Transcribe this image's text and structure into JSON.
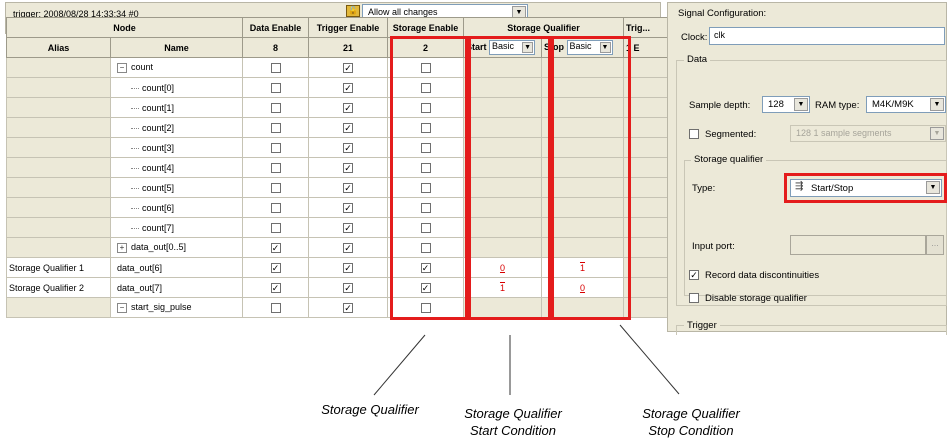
{
  "trigger_bar": {
    "title": "trigger: 2008/08/28 14:33:34  #0",
    "change_mode": "Allow all changes"
  },
  "columns": {
    "node": "Node",
    "alias": "Alias",
    "name": "Name",
    "data_enable": "Data Enable",
    "trigger_enable": "Trigger Enable",
    "storage_enable": "Storage Enable",
    "storage_qualifier": "Storage Qualifier",
    "trig": "Trig...",
    "data_enable_count": "8",
    "trigger_enable_count": "21",
    "storage_enable_count": "2",
    "start": "Start",
    "start_mode": "Basic",
    "stop": "Stop",
    "stop_mode": "Basic",
    "trig_sub": "1 E"
  },
  "rows": [
    {
      "alias": "",
      "name": "count",
      "tree": "minus",
      "indent": 0,
      "data": false,
      "trigger": true,
      "storage": false,
      "start": "",
      "stop": ""
    },
    {
      "alias": "",
      "name": "count[0]",
      "tree": "leaf",
      "indent": 1,
      "data": false,
      "trigger": true,
      "storage": false,
      "start": "",
      "stop": ""
    },
    {
      "alias": "",
      "name": "count[1]",
      "tree": "leaf",
      "indent": 1,
      "data": false,
      "trigger": true,
      "storage": false,
      "start": "",
      "stop": ""
    },
    {
      "alias": "",
      "name": "count[2]",
      "tree": "leaf",
      "indent": 1,
      "data": false,
      "trigger": true,
      "storage": false,
      "start": "",
      "stop": ""
    },
    {
      "alias": "",
      "name": "count[3]",
      "tree": "leaf",
      "indent": 1,
      "data": false,
      "trigger": true,
      "storage": false,
      "start": "",
      "stop": ""
    },
    {
      "alias": "",
      "name": "count[4]",
      "tree": "leaf",
      "indent": 1,
      "data": false,
      "trigger": true,
      "storage": false,
      "start": "",
      "stop": ""
    },
    {
      "alias": "",
      "name": "count[5]",
      "tree": "leaf",
      "indent": 1,
      "data": false,
      "trigger": true,
      "storage": false,
      "start": "",
      "stop": ""
    },
    {
      "alias": "",
      "name": "count[6]",
      "tree": "leaf",
      "indent": 1,
      "data": false,
      "trigger": true,
      "storage": false,
      "start": "",
      "stop": ""
    },
    {
      "alias": "",
      "name": "count[7]",
      "tree": "leaf",
      "indent": 1,
      "data": false,
      "trigger": true,
      "storage": false,
      "start": "",
      "stop": ""
    },
    {
      "alias": "",
      "name": "data_out[0..5]",
      "tree": "plus",
      "indent": 0,
      "data": true,
      "trigger": true,
      "storage": false,
      "start": "",
      "stop": ""
    },
    {
      "alias": "Storage Qualifier 1",
      "name": "data_out[6]",
      "tree": "none",
      "indent": 0,
      "data": true,
      "trigger": true,
      "storage": true,
      "start": "0",
      "stop": "1"
    },
    {
      "alias": "Storage Qualifier 2",
      "name": "data_out[7]",
      "tree": "none",
      "indent": 0,
      "data": true,
      "trigger": true,
      "storage": true,
      "start": "1",
      "stop": "0"
    },
    {
      "alias": "",
      "name": "start_sig_pulse",
      "tree": "minus",
      "indent": 0,
      "data": false,
      "trigger": true,
      "storage": false,
      "start": "",
      "stop": ""
    }
  ],
  "signal_config": {
    "title": "Signal Configuration:",
    "clock_label": "Clock:",
    "clock_value": "clk",
    "data_group": "Data",
    "sample_depth_label": "Sample depth:",
    "sample_depth_value": "128",
    "ram_type_label": "RAM type:",
    "ram_type_value": "M4K/M9K",
    "segmented_label": "Segmented:",
    "segmented_checked": false,
    "segments_value": "128  1 sample segments",
    "storage_qualifier_group": "Storage qualifier",
    "type_label": "Type:",
    "type_value": "Start/Stop",
    "input_port_label": "Input port:",
    "input_port_value": "",
    "record_disc_label": "Record data discontinuities",
    "record_disc_checked": true,
    "disable_sq_label": "Disable storage qualifier",
    "disable_sq_checked": false,
    "trigger_group": "Trigger"
  },
  "callouts": {
    "storage_qualifier": "Storage Qualifier",
    "start_condition_line1": "Storage Qualifier",
    "start_condition_line2": "Start Condition",
    "stop_condition_line1": "Storage Qualifier",
    "stop_condition_line2": "Stop Condition"
  },
  "colors": {
    "highlight_red": "#e41c1c",
    "panel_bg": "#ece9d8",
    "toggle_red": "#d80000"
  }
}
